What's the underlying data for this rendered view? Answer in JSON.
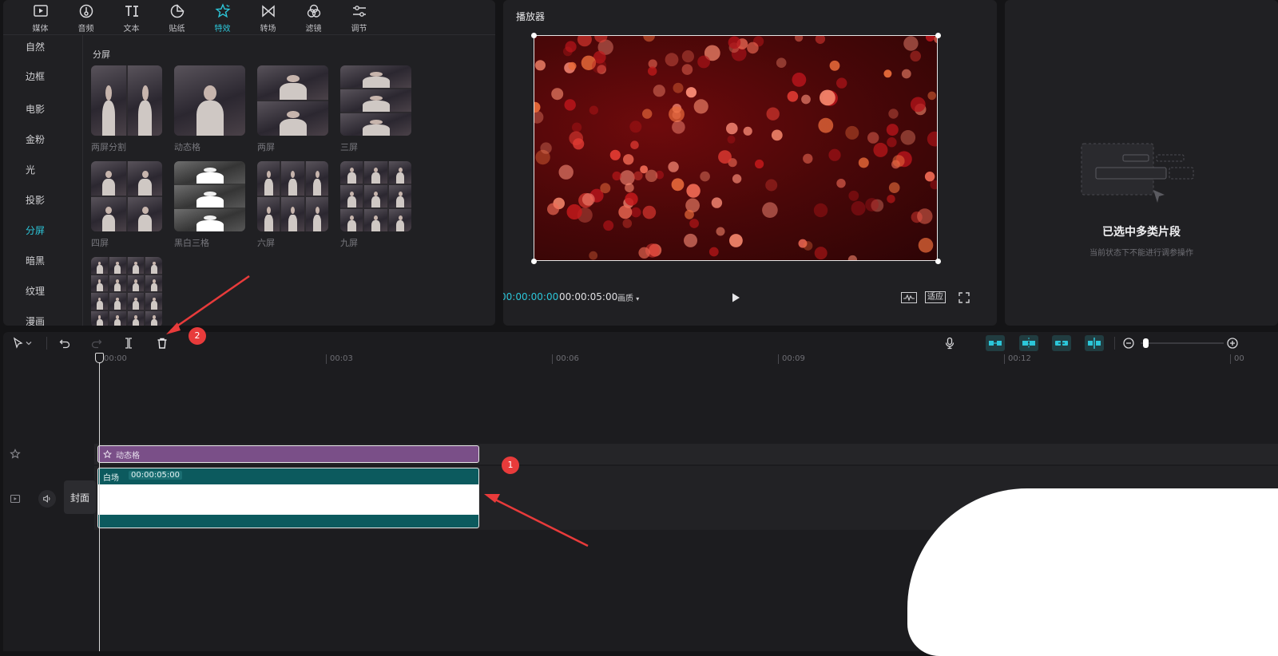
{
  "toolbar": {
    "items": [
      {
        "label": "媒体",
        "icon": "media-icon"
      },
      {
        "label": "音频",
        "icon": "audio-icon"
      },
      {
        "label": "文本",
        "icon": "text-icon"
      },
      {
        "label": "贴纸",
        "icon": "sticker-icon"
      },
      {
        "label": "特效",
        "icon": "effects-icon"
      },
      {
        "label": "转场",
        "icon": "transition-icon"
      },
      {
        "label": "滤镜",
        "icon": "filter-icon"
      },
      {
        "label": "调节",
        "icon": "adjust-icon"
      }
    ],
    "active": "特效"
  },
  "categories": [
    "自然",
    "边框",
    "电影",
    "金粉",
    "光",
    "投影",
    "分屏",
    "暗黑",
    "纹理",
    "漫画"
  ],
  "active_category": "分屏",
  "effects": {
    "section_title": "分屏",
    "cards": [
      "两屏分割",
      "动态格",
      "两屏",
      "三屏",
      "四屏",
      "黑白三格",
      "六屏",
      "九屏"
    ]
  },
  "player": {
    "title": "播放器",
    "current_time": "00:00:00:00",
    "total_time": "00:00:05:00",
    "quality_label": "画质",
    "fit_label": "适应"
  },
  "attributes": {
    "title": "已选中多类片段",
    "subtitle": "当前状态下不能进行调参操作"
  },
  "timeline": {
    "ruler_labels": [
      "00:00",
      "00:03",
      "00:06",
      "00:09",
      "00:12",
      "00"
    ],
    "effect_clip_name": "动态格",
    "video_clip_name": "白场",
    "video_clip_duration": "00:00:05:00",
    "cover_label": "封面"
  },
  "annotations": {
    "badge_1": "1",
    "badge_2": "2"
  },
  "colors": {
    "accent": "#2cc6d9",
    "effect_clip": "#7a4f88",
    "video_clip": "#0c5a5e",
    "annotation_red": "#e83b3b"
  }
}
